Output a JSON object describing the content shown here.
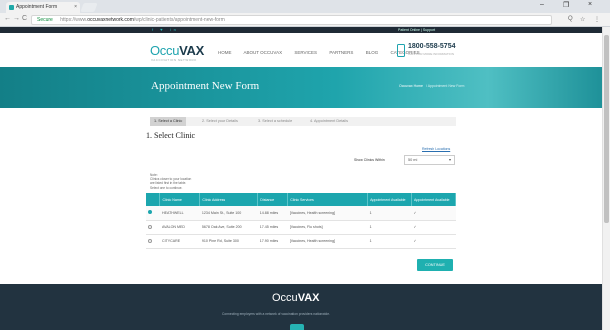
{
  "browser": {
    "tab_title": "Appointment Form",
    "tab_close": "×",
    "nav_back": "←",
    "nav_forward": "→",
    "nav_reload": "C",
    "secure_label": "Secure",
    "url_prefix": "https://www.",
    "url_host": "occuvaxnetwork.com",
    "url_rest": "/wp/clinic-patients/appointment-new-form",
    "win_min": "–",
    "win_max": "❐",
    "win_close": "×",
    "zoom_icon": "Q",
    "star_icon": "☆",
    "menu_icon": "⋮"
  },
  "topstrip": {
    "social": "f  ♥  in",
    "login": "Patient Online  |  Support"
  },
  "header": {
    "logo_occu": "Occu",
    "logo_vax": "VAX",
    "logo_sub": "VACCINATION NETWORK",
    "menu": [
      "HOME",
      "ABOUT OCCUVAX",
      "SERVICES",
      "PARTNERS",
      "BLOG",
      "CATEGORIES"
    ],
    "phone": "1800-558-5754",
    "phone_sub": "CALL FOR MORE INFORMATION"
  },
  "hero": {
    "title": "Appointment New Form",
    "crumb_home": "Occuvax Home",
    "crumb_current": "/ Appointment New Form"
  },
  "steps": [
    "1. Select a Clinic",
    "2. Select your Details",
    "3. Select a schedule",
    "4. Appointment Details"
  ],
  "section_title": "1. Select Clinic",
  "refresh_link": "Refresh Locations",
  "within": {
    "label": "Show Clinics Within",
    "value": "50 mi",
    "caret": "▾"
  },
  "note": [
    "Note:",
    "Clinics closer to your location",
    "are listed first in the table.",
    "Select one to continue."
  ],
  "table": {
    "headers": [
      "",
      "Clinic Name",
      "Clinic Address",
      "Distance",
      "Clinic Services",
      "Appointment Available",
      "Appointment Available"
    ],
    "rows": [
      {
        "selected": true,
        "cells": [
          "HEATHWELL",
          "1234 Main St., Suite 100",
          "14.88 miles",
          "[Vaccines, Health screening]",
          "1",
          "✓"
        ]
      },
      {
        "selected": false,
        "cells": [
          "AVALON MED",
          "5678 Oak Ave, Suite 200",
          "17.45 miles",
          "[Vaccines, Flu shots]",
          "1",
          "✓"
        ]
      },
      {
        "selected": false,
        "cells": [
          "CITYCARE",
          "910 Pine Rd, Suite 300",
          "17.90 miles",
          "[Vaccines, Health screening]",
          "1",
          "✓"
        ]
      }
    ]
  },
  "continue_label": "CONTINUE",
  "footer": {
    "logo_occu": "Occu",
    "logo_vax": "VAX",
    "text": "Connecting employers with a network of vaccination providers nationwide."
  }
}
